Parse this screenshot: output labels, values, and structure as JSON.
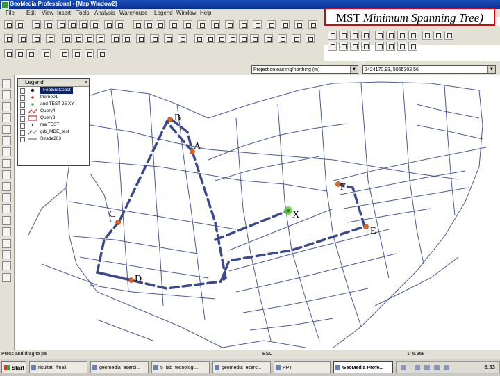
{
  "window": {
    "title": "GeoMedia Professional - [Map Window2]"
  },
  "menu": [
    "File",
    "Edit",
    "View",
    "Insert",
    "Tools",
    "Analysis",
    "Warehouse",
    "Legend",
    "Window",
    "Help"
  ],
  "overlay": {
    "prefix": "MST",
    "italic": "Minimum Spanning Tree)"
  },
  "address": {
    "projection": "Projection easting/northing (m)",
    "coords": "2424170.93, 5055302.56"
  },
  "legend": {
    "title": "Legend",
    "close": "×",
    "items": [
      {
        "label": "FeatureCoast",
        "symbol": "point-dark",
        "selected": true
      },
      {
        "label": "theme01",
        "symbol": "point-red",
        "selected": false
      },
      {
        "label": "and TEST 25 XY",
        "symbol": "point-green",
        "selected": false
      },
      {
        "label": "Query4",
        "symbol": "line-red",
        "selected": false
      },
      {
        "label": "Query3",
        "symbol": "area-red",
        "selected": false
      },
      {
        "label": "rsa TEST",
        "symbol": "point-small",
        "selected": false
      },
      {
        "label": "grb_MDE_test",
        "symbol": "line-dashed",
        "selected": false
      },
      {
        "label": "Strade203",
        "symbol": "line-thin",
        "selected": false
      }
    ]
  },
  "map": {
    "points": [
      {
        "label": "B"
      },
      {
        "label": "A"
      },
      {
        "label": "F"
      },
      {
        "label": "X"
      },
      {
        "label": "C"
      },
      {
        "label": "E"
      },
      {
        "label": "D"
      }
    ],
    "colors": {
      "point": "#e8641e",
      "center": "#5ecf3a",
      "mst": "#3a4a8c",
      "roads": "#4a5a9a"
    }
  },
  "status": {
    "left": "Press and drag to pa",
    "mid": "ESC",
    "scale": "1: 6.968"
  },
  "taskbar": {
    "start": "Start",
    "tasks": [
      "risultati_finali",
      "geomedia_eserci...",
      "5_lab_tecnologi...",
      "geomedia_eserc...",
      "PPT",
      "GeoMedia Profe..."
    ],
    "clock": "6.33"
  }
}
